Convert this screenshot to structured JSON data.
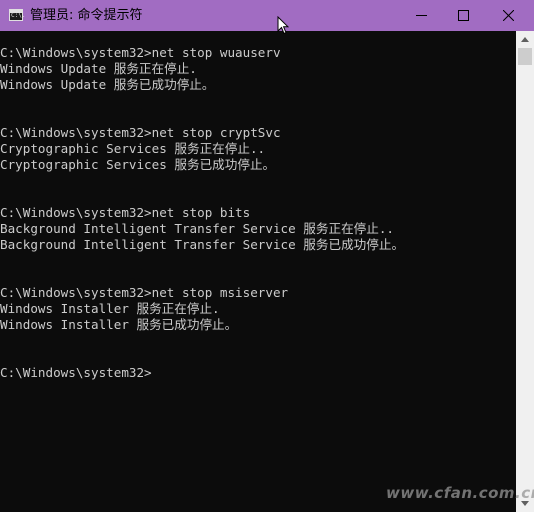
{
  "window": {
    "title": "管理员: 命令提示符",
    "icon": "cmd-icon",
    "icon_label": "C:\\.",
    "titlebar_color": "#a16cc2",
    "controls": [
      "minimize-icon",
      "maximize-icon",
      "close-icon"
    ]
  },
  "console": {
    "background": "#0c0c0c",
    "foreground": "#cccccc",
    "lines": [
      "C:\\Windows\\system32>net stop wuauserv",
      "Windows Update 服务正在停止.",
      "Windows Update 服务已成功停止。",
      "",
      "",
      "C:\\Windows\\system32>net stop cryptSvc",
      "Cryptographic Services 服务正在停止..",
      "Cryptographic Services 服务已成功停止。",
      "",
      "",
      "C:\\Windows\\system32>net stop bits",
      "Background Intelligent Transfer Service 服务正在停止..",
      "Background Intelligent Transfer Service 服务已成功停止。",
      "",
      "",
      "C:\\Windows\\system32>net stop msiserver",
      "Windows Installer 服务正在停止.",
      "Windows Installer 服务已成功停止。",
      "",
      "",
      "C:\\Windows\\system32>"
    ]
  },
  "watermark": "www.cfan.com.cn"
}
